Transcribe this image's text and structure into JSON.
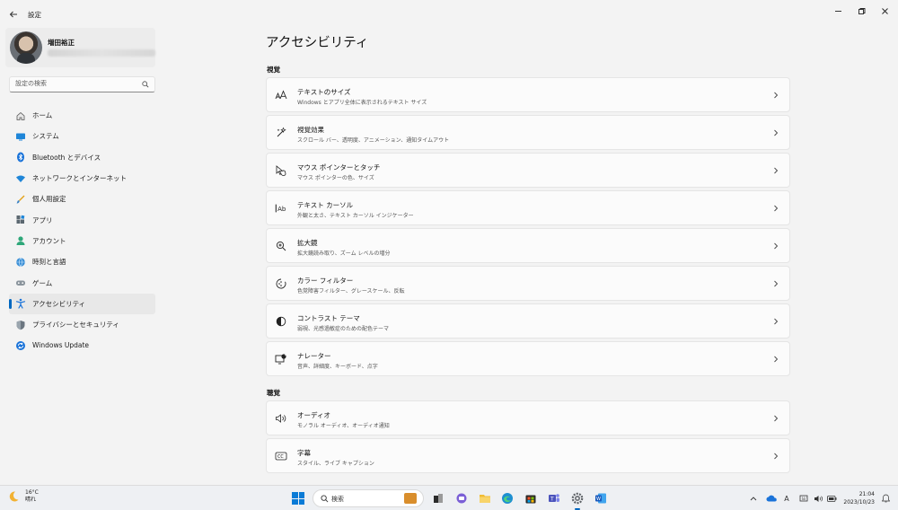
{
  "window": {
    "title": "設定",
    "back_icon": "arrow-left-icon",
    "minimize_icon": "minimize-icon",
    "restore_icon": "restore-icon",
    "close_icon": "close-icon"
  },
  "profile": {
    "name": "増田裕正"
  },
  "search": {
    "placeholder": "設定の検索"
  },
  "sidebar": {
    "items": [
      {
        "label": "ホーム",
        "icon": "home-icon"
      },
      {
        "label": "システム",
        "icon": "system-icon"
      },
      {
        "label": "Bluetooth とデバイス",
        "icon": "bluetooth-icon"
      },
      {
        "label": "ネットワークとインターネット",
        "icon": "network-icon"
      },
      {
        "label": "個人用設定",
        "icon": "personalization-icon"
      },
      {
        "label": "アプリ",
        "icon": "apps-icon"
      },
      {
        "label": "アカウント",
        "icon": "account-icon"
      },
      {
        "label": "時刻と言語",
        "icon": "time-language-icon"
      },
      {
        "label": "ゲーム",
        "icon": "gaming-icon"
      },
      {
        "label": "アクセシビリティ",
        "icon": "accessibility-icon",
        "active": true
      },
      {
        "label": "プライバシーとセキュリティ",
        "icon": "shield-icon"
      },
      {
        "label": "Windows Update",
        "icon": "windows-update-icon"
      }
    ]
  },
  "main": {
    "title": "アクセシビリティ",
    "sections": [
      {
        "heading": "視覚",
        "cards": [
          {
            "title": "テキストのサイズ",
            "subtitle": "Windows とアプリ全体に表示されるテキスト サイズ",
            "icon": "text-size-icon"
          },
          {
            "title": "視覚効果",
            "subtitle": "スクロール バー、透明度、アニメーション、通知タイムアウト",
            "icon": "visual-effects-icon"
          },
          {
            "title": "マウス ポインターとタッチ",
            "subtitle": "マウス ポインターの色、サイズ",
            "icon": "mouse-pointer-icon"
          },
          {
            "title": "テキスト カーソル",
            "subtitle": "外観と太さ、テキスト カーソル インジケーター",
            "icon": "text-cursor-icon"
          },
          {
            "title": "拡大鏡",
            "subtitle": "拡大鏡読み取り、ズーム レベルの増分",
            "icon": "magnifier-icon"
          },
          {
            "title": "カラー フィルター",
            "subtitle": "色覚障害フィルター、グレースケール、反転",
            "icon": "color-filter-icon"
          },
          {
            "title": "コントラスト テーマ",
            "subtitle": "弱視、光感過敏症のための配色テーマ",
            "icon": "contrast-icon"
          },
          {
            "title": "ナレーター",
            "subtitle": "音声、詳細度、キーボード、点字",
            "icon": "narrator-icon"
          }
        ]
      },
      {
        "heading": "聴覚",
        "cards": [
          {
            "title": "オーディオ",
            "subtitle": "モノラル オーディオ、オーディオ通知",
            "icon": "audio-icon"
          },
          {
            "title": "字幕",
            "subtitle": "スタイル、ライブ キャプション",
            "icon": "captions-icon"
          }
        ]
      }
    ]
  },
  "taskbar": {
    "weather": {
      "temp": "16°C",
      "condition": "晴れ",
      "icon": "moon-weather-icon"
    },
    "search_label": "検索",
    "apps": [
      "file-explorer-icon",
      "chat-icon",
      "folder-icon",
      "edge-icon",
      "store-icon",
      "teams-icon",
      "settings-icon",
      "word-icon"
    ],
    "tray": [
      "chevron-up-icon",
      "onedrive-icon",
      "ime-icon",
      "speaker-icon",
      "battery-icon"
    ],
    "ime_label": "A",
    "time": "21:04",
    "date": "2023/10/23"
  },
  "colors": {
    "accent": "#0067c0",
    "background": "#f3f3f3",
    "card": "#fbfbfb"
  }
}
